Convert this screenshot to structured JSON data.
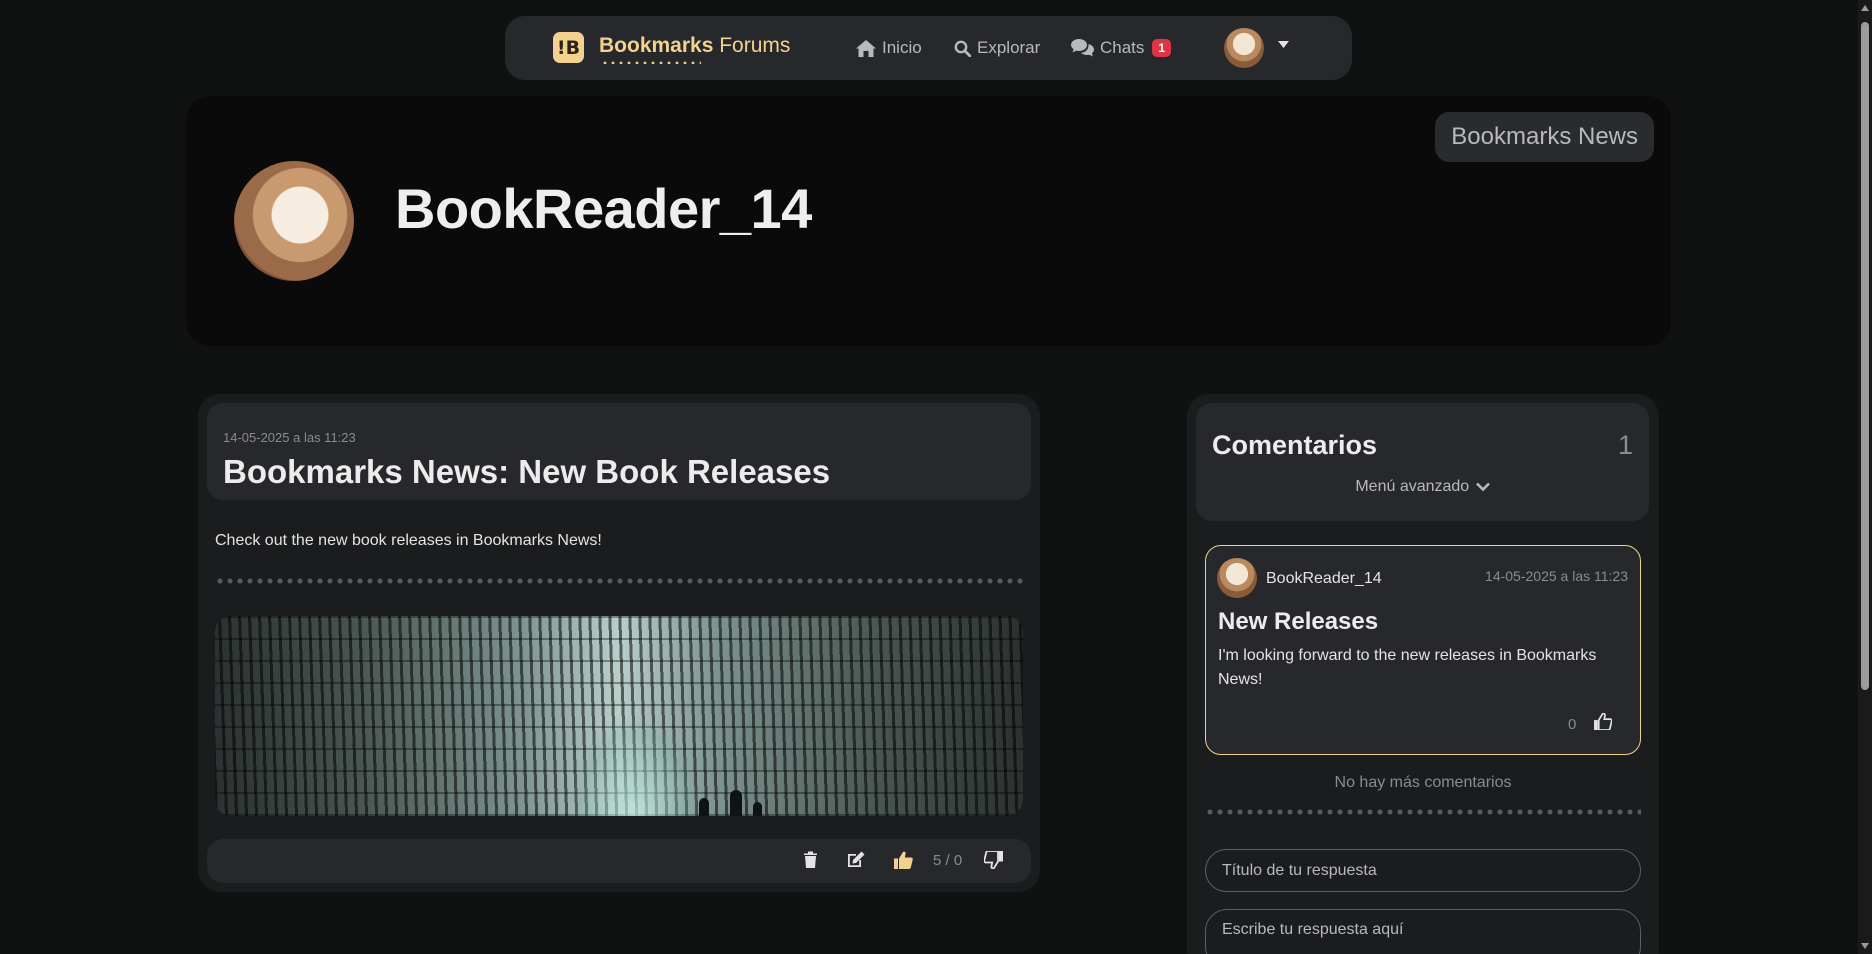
{
  "navbar": {
    "brand_bold": "Bookmarks",
    "brand_rest": " Forums",
    "logo_glyph": "!B",
    "links": {
      "inicio": "Inicio",
      "explorar": "Explorar",
      "chats": "Chats"
    },
    "chats_badge": "1",
    "icons": [
      "home-icon",
      "search-icon",
      "chat-icon",
      "caret-down-icon"
    ]
  },
  "profile": {
    "tag": "Bookmarks News",
    "username": "BookReader_14"
  },
  "post": {
    "date": "14-05-2025 a las 11:23",
    "title": "Bookmarks News: New Book Releases",
    "body": "Check out the new book releases in Bookmarks News!",
    "votes": "5 / 0",
    "icons": [
      "trash-icon",
      "edit-icon",
      "thumbs-up-icon",
      "thumbs-down-icon"
    ]
  },
  "comments": {
    "title": "Comentarios",
    "count": "1",
    "advanced_menu": "Menú avanzado",
    "items": [
      {
        "user": "BookReader_14",
        "date": "14-05-2025 a las 11:23",
        "title": "New Releases",
        "body": "I'm looking forward to the new releases in Bookmarks News!",
        "likes": "0"
      }
    ],
    "no_more": "No hay más comentarios",
    "reply_title_placeholder": "Título de tu respuesta",
    "reply_body_placeholder": "Escribe tu respuesta aquí"
  },
  "colors": {
    "accent": "#f3d28d",
    "background": "#101111",
    "card": "#1b1c1e",
    "panel": "#27282b",
    "badge": "#dc3545"
  }
}
